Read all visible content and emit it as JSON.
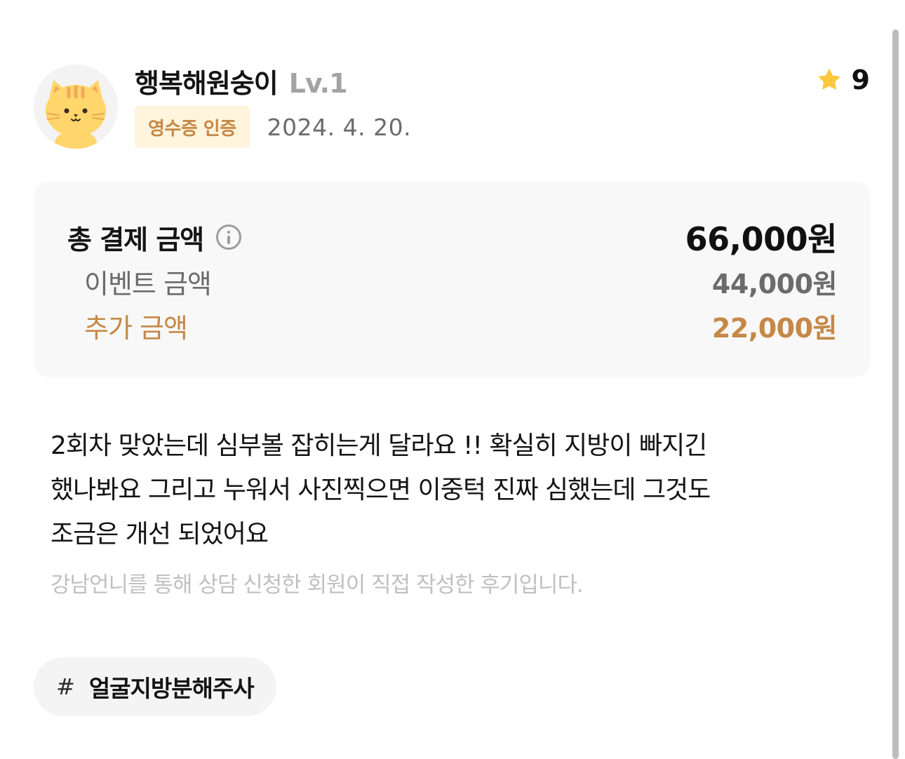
{
  "review": {
    "author": {
      "name": "행복해원숭이",
      "level": "Lv.1",
      "avatar_icon": "cat-avatar-icon"
    },
    "rating": {
      "icon": "star-icon",
      "value": "9",
      "star_color": "#FFC83D"
    },
    "badge": "영수증 인증",
    "date": "2024. 4. 20.",
    "price": {
      "total_label": "총 결제 금액",
      "total_value": "66,000원",
      "info_icon": "info-icon",
      "event_label": "이벤트 금액",
      "event_value": "44,000원",
      "extra_label": "추가 금액",
      "extra_value": "22,000원",
      "accent_color": "#C58846"
    },
    "body_lines": [
      "2회차 맞았는데 심부볼 잡히는게 달라요 !! 확실히 지방이 빠지긴",
      "했나봐요 그리고 누워서 사진찍으면 이중턱 진짜 심했는데 그것도",
      "조금은 개선 되었어요"
    ],
    "disclaimer": "강남언니를 통해 상담 신청한 회원이 직접 작성한 후기입니다.",
    "hashtag": {
      "symbol": "#",
      "text": "얼굴지방분해주사"
    }
  }
}
